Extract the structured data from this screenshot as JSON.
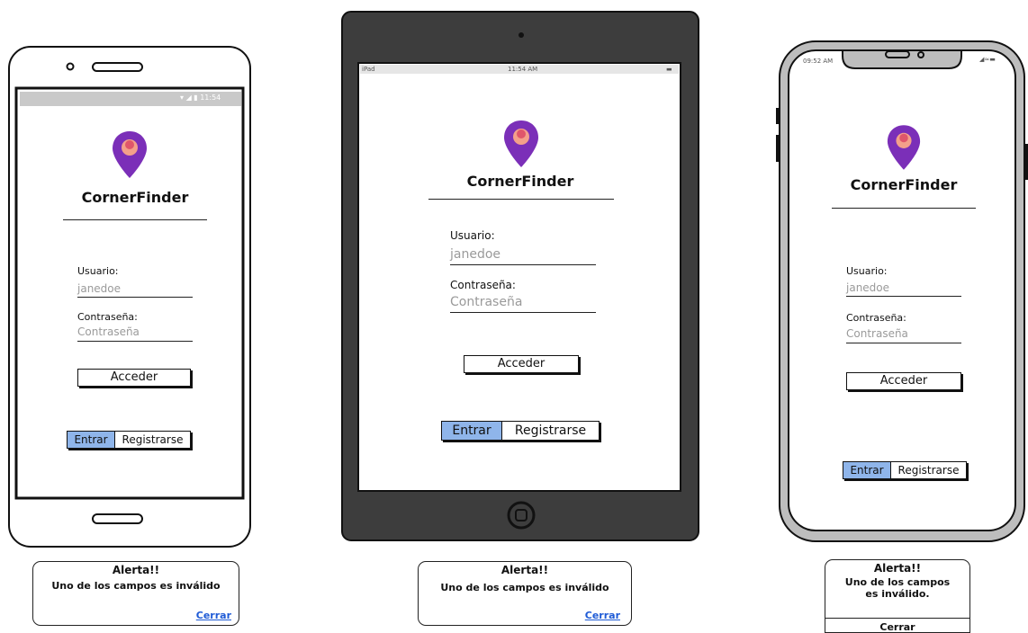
{
  "app": {
    "name": "CornerFinder",
    "username_label": "Usuario:",
    "username_value": "janedoe",
    "password_label": "Contraseña:",
    "password_placeholder": "Contraseña",
    "login_button": "Acceder",
    "tab_login": "Entrar",
    "tab_register": "Registrarse"
  },
  "status": {
    "android_time": "11:54",
    "ipad_carrier": "iPad",
    "ipad_time": "11:54 AM",
    "iphone_time": "09:52 AM"
  },
  "alert": {
    "title": "Alerta!!",
    "message": "Uno de los campos es inválido",
    "message_variant": "Uno de los campos es inválido.",
    "close": "Cerrar"
  },
  "colors": {
    "pin": "#7b2fb8",
    "active_tab": "#8fb5ea",
    "link": "#1f5bd6",
    "tablet_body": "#3d3d3d",
    "iphone_body": "#bdbdbd"
  },
  "icons": [
    "location-pin-icon",
    "wifi-icon",
    "signal-icon",
    "battery-icon",
    "home-button-icon",
    "camera-icon",
    "speaker-icon"
  ]
}
